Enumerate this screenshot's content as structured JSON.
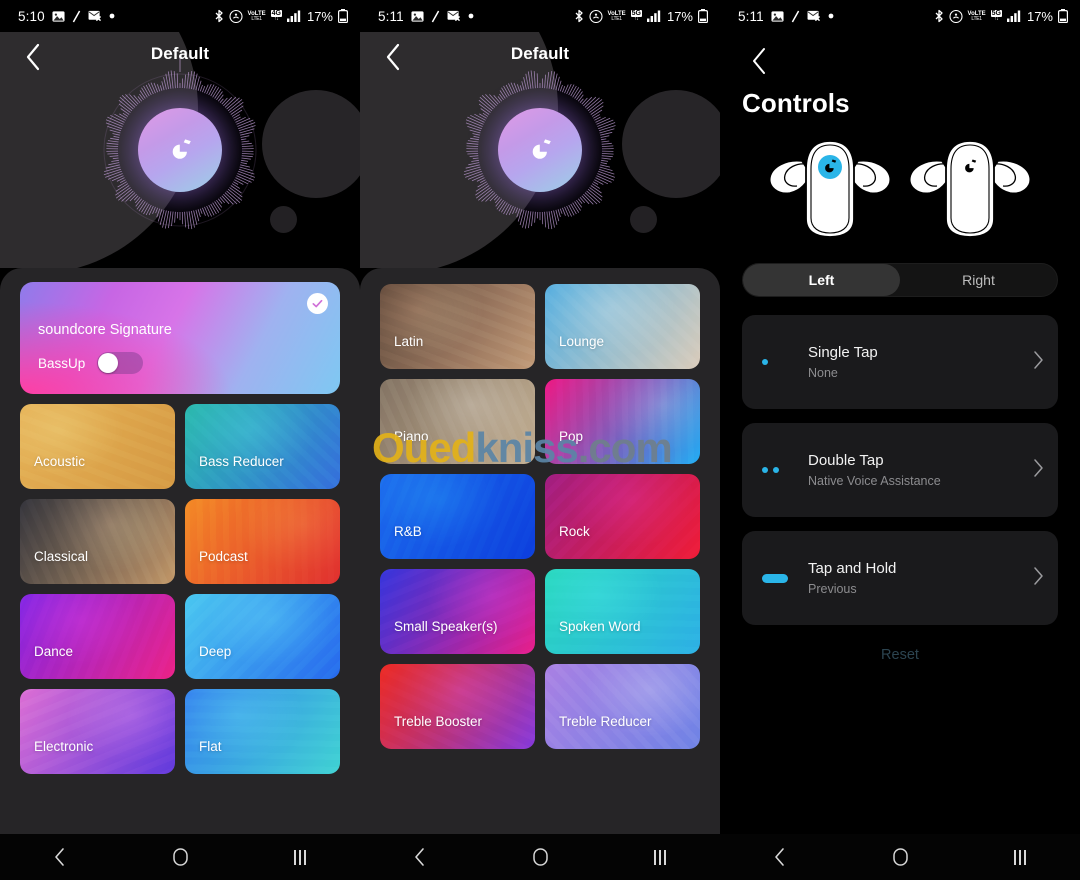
{
  "statusbars": [
    {
      "time": "5:10",
      "battery": "17%",
      "network": "4G",
      "volte": "VoLTE",
      "icons": [
        "photo-icon",
        "slash-icon",
        "mail-icon",
        "dot-icon",
        "bluetooth-icon",
        "wifi-calling-icon",
        "volte-icon",
        "signal-icon",
        "battery-icon"
      ]
    },
    {
      "time": "5:11",
      "battery": "17%",
      "network": "5G",
      "volte": "VoLTE",
      "icons": [
        "photo-icon",
        "slash-icon",
        "mail-icon",
        "dot-icon",
        "bluetooth-icon",
        "wifi-calling-icon",
        "volte-icon",
        "signal-icon",
        "battery-icon"
      ]
    },
    {
      "time": "5:11",
      "battery": "17%",
      "network": "5G",
      "volte": "VoLTE",
      "icons": [
        "photo-icon",
        "slash-icon",
        "mail-icon",
        "dot-icon",
        "bluetooth-icon",
        "wifi-calling-icon",
        "volte-icon",
        "signal-icon",
        "battery-icon"
      ]
    }
  ],
  "panel1": {
    "header": {
      "title": "Default",
      "back_icon": "chevron-left-icon"
    },
    "signature": {
      "name": "soundcore Signature",
      "bassup_label": "BassUp",
      "bassup_on": false,
      "selected": true
    },
    "presets": [
      {
        "label": "Acoustic",
        "c1": "#e8b85e",
        "c2": "#d9a24a"
      },
      {
        "label": "Bass Reducer",
        "c1": "#2fc0b4",
        "c2": "#3a7ae0"
      },
      {
        "label": "Classical",
        "c1": "#3a3a42",
        "c2": "#c8a173"
      },
      {
        "label": "Podcast",
        "c1": "#f5952a",
        "c2": "#e33434"
      },
      {
        "label": "Dance",
        "c1": "#8b2ae8",
        "c2": "#ee2590"
      },
      {
        "label": "Deep",
        "c1": "#52cdf2",
        "c2": "#2a74ef"
      },
      {
        "label": "Electronic",
        "c1": "#e07ad8",
        "c2": "#6b3fe0"
      },
      {
        "label": "Flat",
        "c1": "#3a8bf0",
        "c2": "#46d6d6"
      }
    ]
  },
  "panel2": {
    "header": {
      "title": "Default",
      "back_icon": "chevron-left-icon"
    },
    "presets": [
      {
        "label": "Latin",
        "c1": "#6a5040",
        "c2": "#c7a383"
      },
      {
        "label": "Lounge",
        "c1": "#62b6e3",
        "c2": "#ded0c0"
      },
      {
        "label": "Piano",
        "c1": "#8e7f6e",
        "c2": "#c8b69c"
      },
      {
        "label": "Pop",
        "c1": "#f01a8e",
        "c2": "#25b4f5"
      },
      {
        "label": "R&B",
        "c1": "#1f77ef",
        "c2": "#0d44e0"
      },
      {
        "label": "Rock",
        "c1": "#a8218e",
        "c2": "#f11f3c"
      },
      {
        "label": "Small Speaker(s)",
        "c1": "#3a3ae0",
        "c2": "#ec2194"
      },
      {
        "label": "Spoken Word",
        "c1": "#2ddbc3",
        "c2": "#31b6e8"
      },
      {
        "label": "Treble Booster",
        "c1": "#ef2e26",
        "c2": "#8f3fe0"
      },
      {
        "label": "Treble Reducer",
        "c1": "#b18be6",
        "c2": "#7b8ee8"
      }
    ]
  },
  "panel3": {
    "back_icon": "chevron-left-icon",
    "title": "Controls",
    "earbuds": {
      "left_icon": "earbud-left-icon",
      "right_icon": "earbud-right-icon",
      "accent": "#2ab5e8"
    },
    "segments": [
      {
        "label": "Left",
        "active": true
      },
      {
        "label": "Right",
        "active": false
      }
    ],
    "rows": [
      {
        "name": "Single Tap",
        "value": "None",
        "gesture": "single-dot",
        "chevron": "chevron-right-icon"
      },
      {
        "name": "Double Tap",
        "value": "Native Voice Assistance",
        "gesture": "double-dot",
        "chevron": "chevron-right-icon"
      },
      {
        "name": "Tap and Hold",
        "value": "Previous",
        "gesture": "hold-bar",
        "chevron": "chevron-right-icon"
      }
    ],
    "reset_label": "Reset"
  },
  "navbar": {
    "back_icon": "nav-back-icon",
    "home_icon": "nav-home-icon",
    "recents_icon": "nav-recents-icon"
  },
  "watermark": {
    "part_a": "Oued",
    "part_b": "kniss",
    "part_c": ".com"
  }
}
